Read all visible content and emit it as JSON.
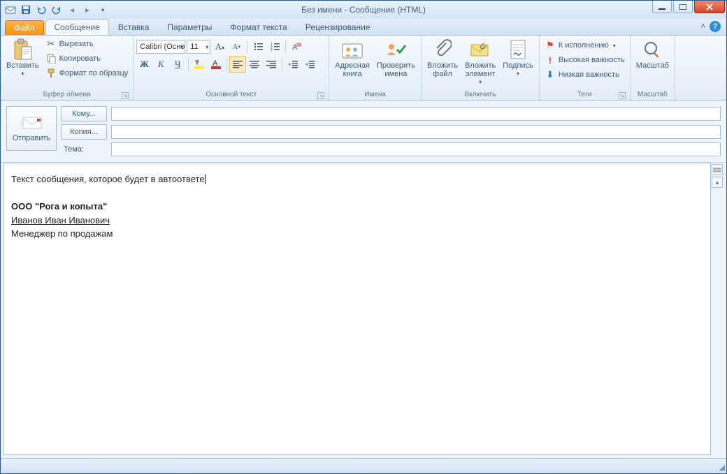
{
  "window": {
    "title": "Без имени  -  Сообщение (HTML)"
  },
  "file_tab": "Файл",
  "tabs": [
    "Сообщение",
    "Вставка",
    "Параметры",
    "Формат текста",
    "Рецензирование"
  ],
  "active_tab_index": 0,
  "ribbon": {
    "clipboard": {
      "label": "Буфер обмена",
      "paste": "Вставить",
      "cut": "Вырезать",
      "copy": "Копировать",
      "format_painter": "Формат по образцу"
    },
    "font": {
      "label": "Основной текст",
      "font_name": "Calibri (Основной текст)",
      "font_size": "11"
    },
    "names": {
      "label": "Имена",
      "address_book": "Адресная\nкнига",
      "check_names": "Проверить\nимена"
    },
    "include": {
      "label": "Включить",
      "attach_file": "Вложить\nфайл",
      "attach_item": "Вложить\nэлемент",
      "signature": "Подпись"
    },
    "tags": {
      "label": "Теги",
      "follow_up": "К исполнению",
      "high_importance": "Высокая важность",
      "low_importance": "Низкая важность"
    },
    "zoom": {
      "label": "Масштаб",
      "zoom": "Масштаб"
    }
  },
  "compose": {
    "send": "Отправить",
    "to_btn": "Кому...",
    "cc_btn": "Копия...",
    "subject_label": "Тема:",
    "to_value": "",
    "cc_value": "",
    "subject_value": ""
  },
  "body": {
    "line1": "Текст сообщения, которое будет в автоответе",
    "sig_company": "ООО \"Рога и копыта\"",
    "sig_name": "Иванов Иван Иванович",
    "sig_title": "Менеджер по продажам"
  }
}
